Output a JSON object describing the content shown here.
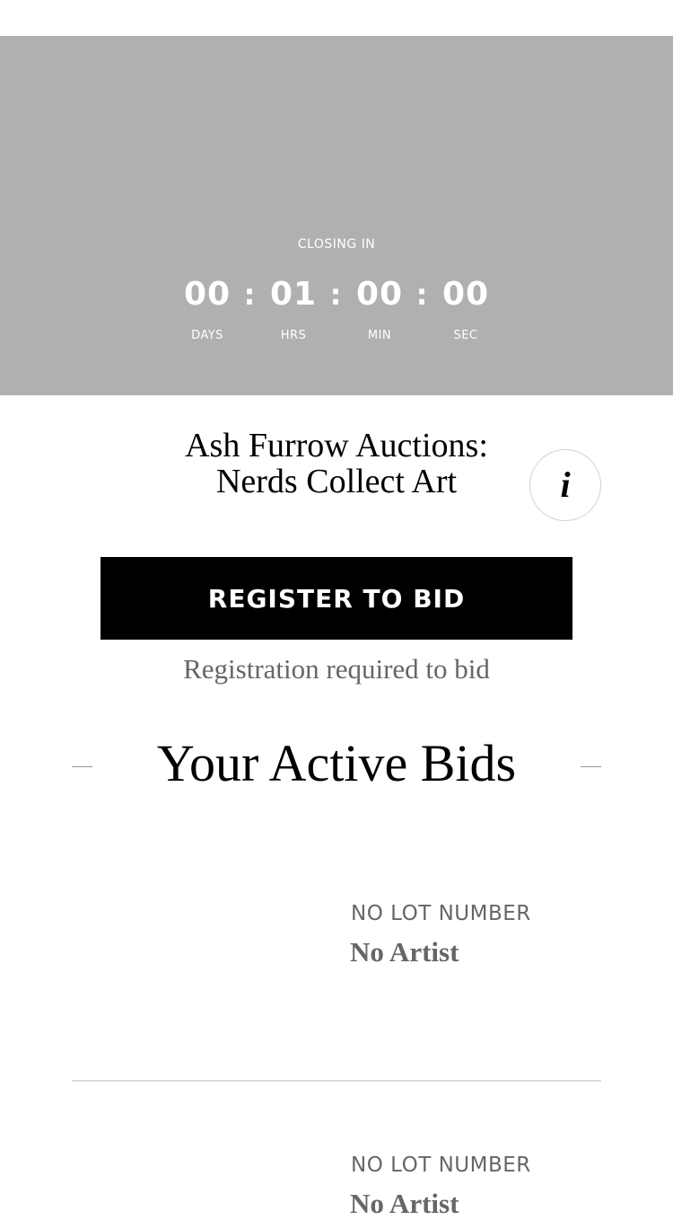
{
  "countdown": {
    "label": "CLOSING IN",
    "separator": ":",
    "units": [
      {
        "value": "00",
        "label": "DAYS"
      },
      {
        "value": "01",
        "label": "HRS"
      },
      {
        "value": "00",
        "label": "MIN"
      },
      {
        "value": "00",
        "label": "SEC"
      }
    ]
  },
  "sale": {
    "title": "Ash Furrow Auctions: Nerds Collect Art",
    "info_icon": "info-icon"
  },
  "register": {
    "button_label": "REGISTER TO BID",
    "note": "Registration required to bid"
  },
  "active_bids": {
    "heading": "Your Active Bids",
    "items": [
      {
        "lot": "NO LOT NUMBER",
        "artist": "No Artist"
      },
      {
        "lot": "NO LOT NUMBER",
        "artist": "No Artist"
      }
    ]
  },
  "colors": {
    "hero_background": "#b0b0b0",
    "button_background": "#000000",
    "muted_text": "#666666"
  }
}
